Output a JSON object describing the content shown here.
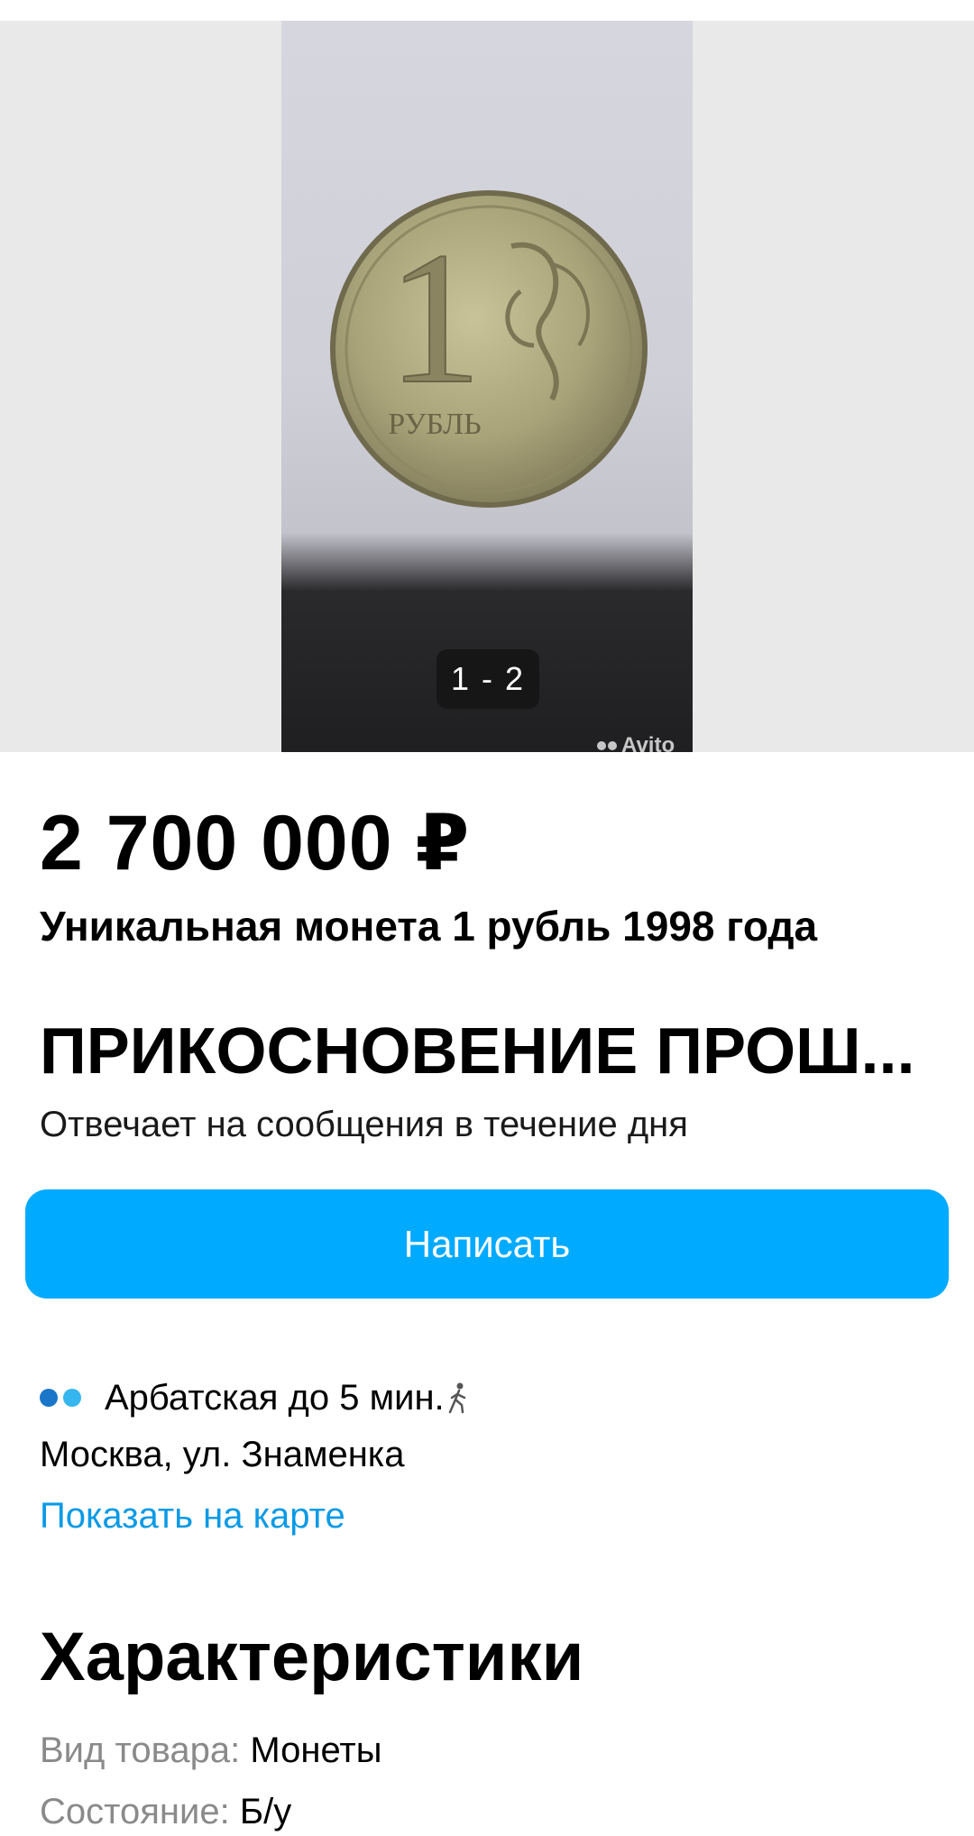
{
  "gallery": {
    "counter": "1 - 2",
    "watermark": "Avito",
    "coin_text": "РУБЛЬ",
    "coin_numeral": "1"
  },
  "listing": {
    "price": "2 700 000 ₽",
    "title": "Уникальная монета 1 рубль 1998 года"
  },
  "seller": {
    "name": "ПРИКОСНОВЕНИЕ ПРОШ...",
    "reply_time": "Отвечает на сообщения в течение дня",
    "write_button": "Написать"
  },
  "location": {
    "metro": "Арбатская до 5 мин.",
    "metro_colors": [
      "#1a76c8",
      "#35b6ee"
    ],
    "address": "Москва, ул. Знаменка",
    "map_link": "Показать на карте"
  },
  "characteristics": {
    "title": "Характеристики",
    "items": [
      {
        "key": "Вид товара:",
        "value": "Монеты"
      },
      {
        "key": "Состояние:",
        "value": "Б/у"
      }
    ]
  },
  "colors": {
    "accent": "#00aaff",
    "link": "#0a9ae6"
  }
}
